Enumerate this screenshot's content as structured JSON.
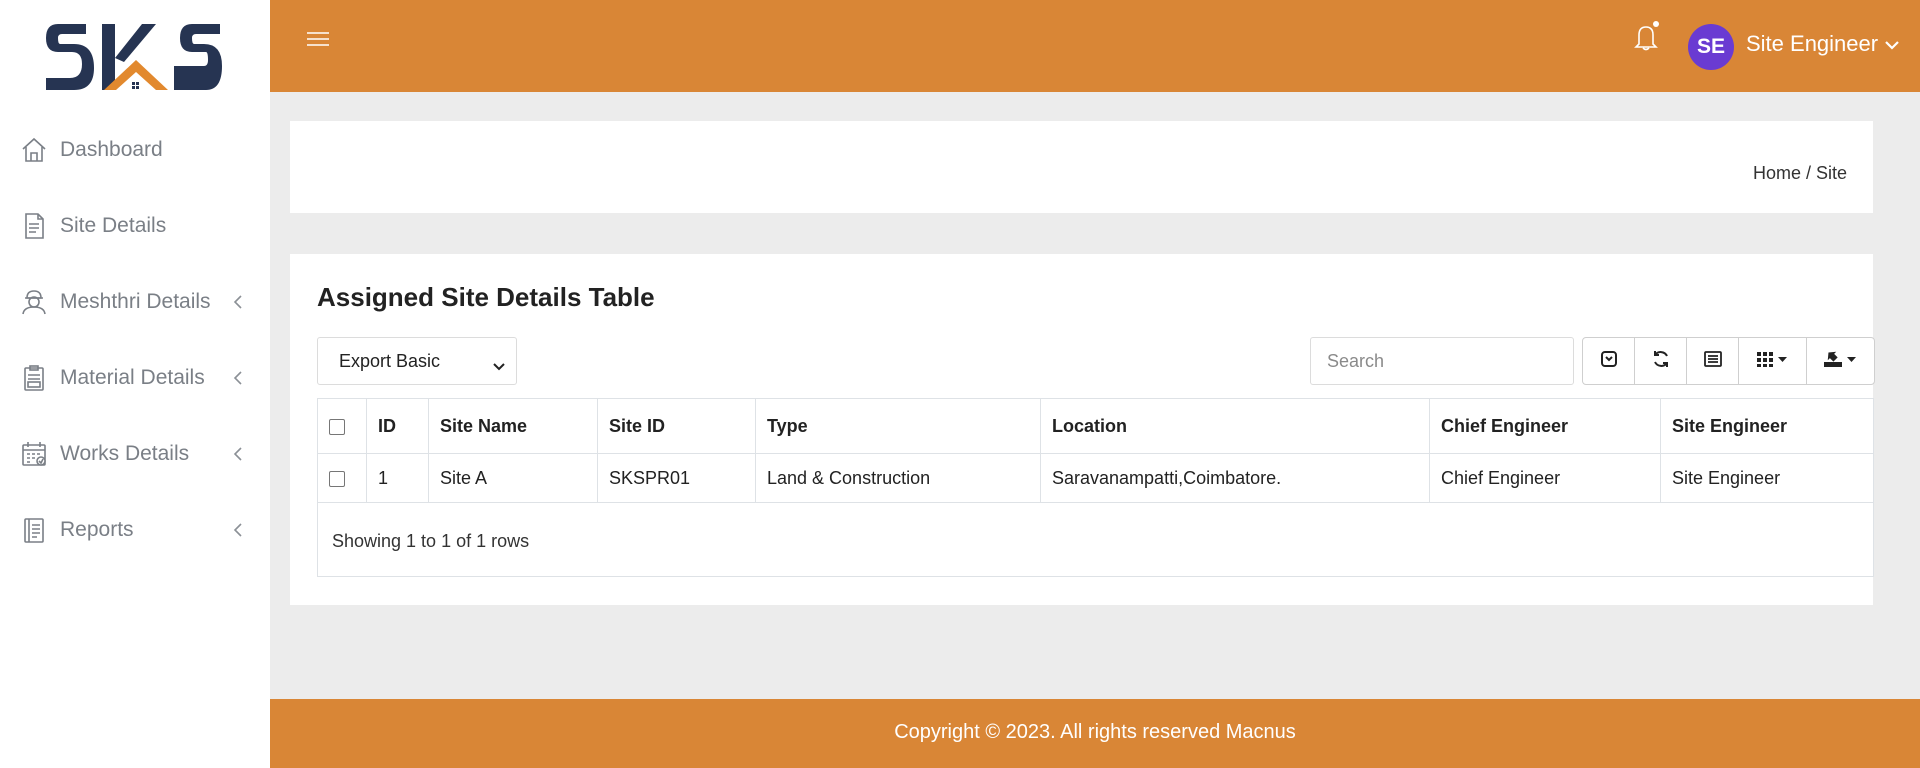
{
  "brand": {
    "logo_text": "SKS",
    "accent": "#d98636",
    "navy": "#263452"
  },
  "sidebar": {
    "items": [
      {
        "label": "Dashboard",
        "icon": "home-icon",
        "has_submenu": false
      },
      {
        "label": "Site Details",
        "icon": "document-icon",
        "has_submenu": false
      },
      {
        "label": "Meshthri Details",
        "icon": "worker-icon",
        "has_submenu": true
      },
      {
        "label": "Material Details",
        "icon": "clipboard-icon",
        "has_submenu": true
      },
      {
        "label": "Works Details",
        "icon": "calendar-icon",
        "has_submenu": true
      },
      {
        "label": "Reports",
        "icon": "report-icon",
        "has_submenu": true
      }
    ]
  },
  "header": {
    "avatar_initials": "SE",
    "user_name": "Site Engineer",
    "avatar_color": "#6a3bd2"
  },
  "breadcrumb": {
    "text": "Home / Site"
  },
  "table_card": {
    "title": "Assigned Site Details Table",
    "export_select": {
      "selected": "Export Basic"
    },
    "search": {
      "placeholder": "Search",
      "value": ""
    },
    "toolbar_icons": [
      "toggle-icon",
      "refresh-icon",
      "card-view-icon",
      "columns-icon",
      "export-icon"
    ],
    "columns": [
      "ID",
      "Site Name",
      "Site ID",
      "Type",
      "Location",
      "Chief Engineer",
      "Site Engineer"
    ],
    "rows": [
      [
        "1",
        "Site A",
        "SKSPR01",
        "Land & Construction",
        "Saravanampatti,Coimbatore.",
        "Chief Engineer",
        "Site Engineer"
      ]
    ],
    "showing_text": "Showing 1 to 1 of 1 rows"
  },
  "footer": {
    "copyright": "Copyright © 2023. All rights reserved Macnus"
  }
}
